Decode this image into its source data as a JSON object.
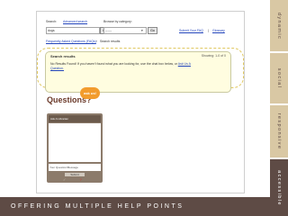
{
  "search": {
    "label": "Search:",
    "advanced_link": "Advanced search",
    "query_value": "dogs",
    "go_label": "Go"
  },
  "browse": {
    "label": "Browse by category:",
    "selected_value": "------",
    "go_label": "Go"
  },
  "header_links": {
    "submit_faq": "Submit Your FAQ",
    "separator": "|",
    "glossary": "Glossary"
  },
  "breadcrumb": {
    "home": "Frequently Asked Questions (FAQs)",
    "current": "Search results"
  },
  "results": {
    "heading": "Search results",
    "showing": "Showing: 1-0 of 0",
    "message": "No Results Found! If you haven't found what you are looking for, use the chat box below, or",
    "ask_link": "Ask Us A Question."
  },
  "chat": {
    "questions_label": "Questions?",
    "ask_bubble": "ask us!",
    "widget_title": "Ask A Librarian",
    "input_placeholder": "Your Question/Message",
    "submit_label": "Submit"
  },
  "side_tabs": [
    "dynamic",
    "social",
    "responsive",
    "accessible"
  ],
  "banner": "OFFERING MULTIPLE HELP POINTS",
  "colors": {
    "accent_dark": "#5e4b45",
    "tab_light": "#d9c8a4",
    "bubble_orange": "#f29c2e",
    "results_bg": "#fffde0"
  }
}
